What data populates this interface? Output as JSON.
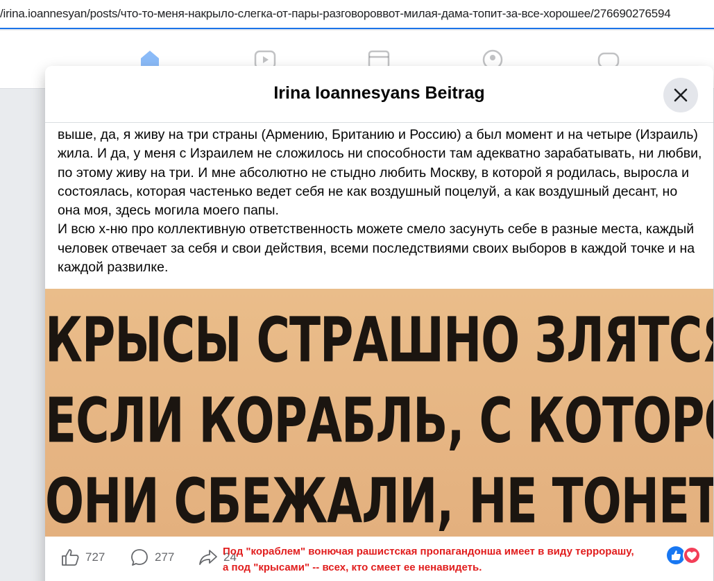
{
  "browser": {
    "url": "/irina.ioannesyan/posts/что-то-меня-накрыло-слегка-от-пары-разговороввот-милая-дама-топит-за-все-хорошее/276690276594"
  },
  "modal": {
    "title": "Irina Ioannesyans Beitrag",
    "close_icon": "close-icon"
  },
  "post": {
    "paragraphs": [
      "выше, да, я живу на три страны (Армению, Британию и Россию) а был момент и на четыре (Израиль) жила. И да, у меня с Израилем не сложилось ни способности там адекватно зарабатывать, ни любви, по этому живу на три. И мне абсолютно не стыдно любить Москву, в которой я родилась, выросла и состоялась, которая частенько ведет себя не как воздушный поцелуй, а как воздушный десант, но она моя, здесь могила моего папы.",
      "И всю х-ню про коллективную ответственность можете смело засунуть себе в разные места, каждый человек отвечает за себя и свои действия, всеми последствиями своих выборов в каждой точке и на каждой развилке."
    ],
    "image_text": [
      "КРЫСЫ СТРАШНО ЗЛЯТСЯ,",
      "ЕСЛИ КОРАБЛЬ, С КОТОРОГО",
      "ОНИ СБЕЖАЛИ, НЕ ТОНЕТ"
    ]
  },
  "footer": {
    "likes": "727",
    "comments": "277",
    "shares": "24",
    "annotation_line1": "Под \"кораблем\" вонючая рашистская пропагандонша имеет в виду террорашу,",
    "annotation_line2": "а под \"крысами\" -- всех, кто смеет ее ненавидеть."
  },
  "colors": {
    "accent": "#1a73e8",
    "annotation": "#e11d1d",
    "meme_bg": "#e6b583",
    "like_blue": "#1877f2",
    "love_red": "#f33e58"
  }
}
